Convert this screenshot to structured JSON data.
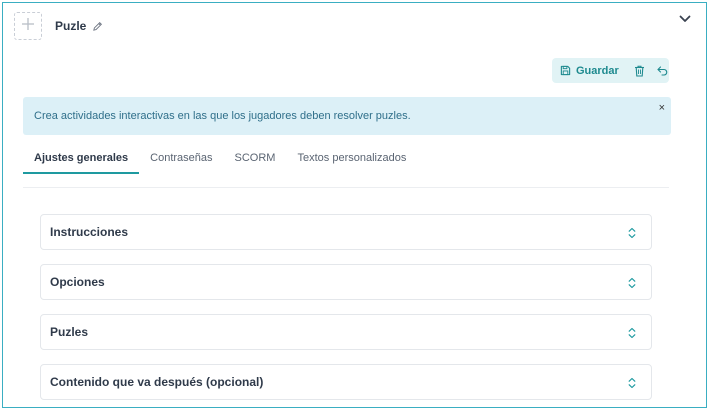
{
  "header": {
    "title": "Puzle"
  },
  "toolbar": {
    "save_label": "Guardar"
  },
  "alert": {
    "text": "Crea actividades interactivas en las que los jugadores deben resolver puzles.",
    "close": "×"
  },
  "tabs": [
    {
      "label": "Ajustes generales",
      "active": true
    },
    {
      "label": "Contraseñas",
      "active": false
    },
    {
      "label": "SCORM",
      "active": false
    },
    {
      "label": "Textos personalizados",
      "active": false
    }
  ],
  "sections": [
    {
      "label": "Instrucciones"
    },
    {
      "label": "Opciones"
    },
    {
      "label": "Puzles"
    },
    {
      "label": "Contenido que va después (opcional)"
    }
  ],
  "colors": {
    "accent": "#1e9aa0",
    "frame_border": "#3aaec2",
    "alert_bg": "#dcf0f7",
    "toolbar_bg": "#e1f3f5"
  },
  "icons": {
    "add": "plus-icon",
    "edit": "pencil-icon",
    "collapse": "chevron-down-icon",
    "save": "floppy-disk-icon",
    "delete": "trash-icon",
    "undo": "undo-arrow-icon",
    "expand": "chevron-up-down-icon"
  }
}
